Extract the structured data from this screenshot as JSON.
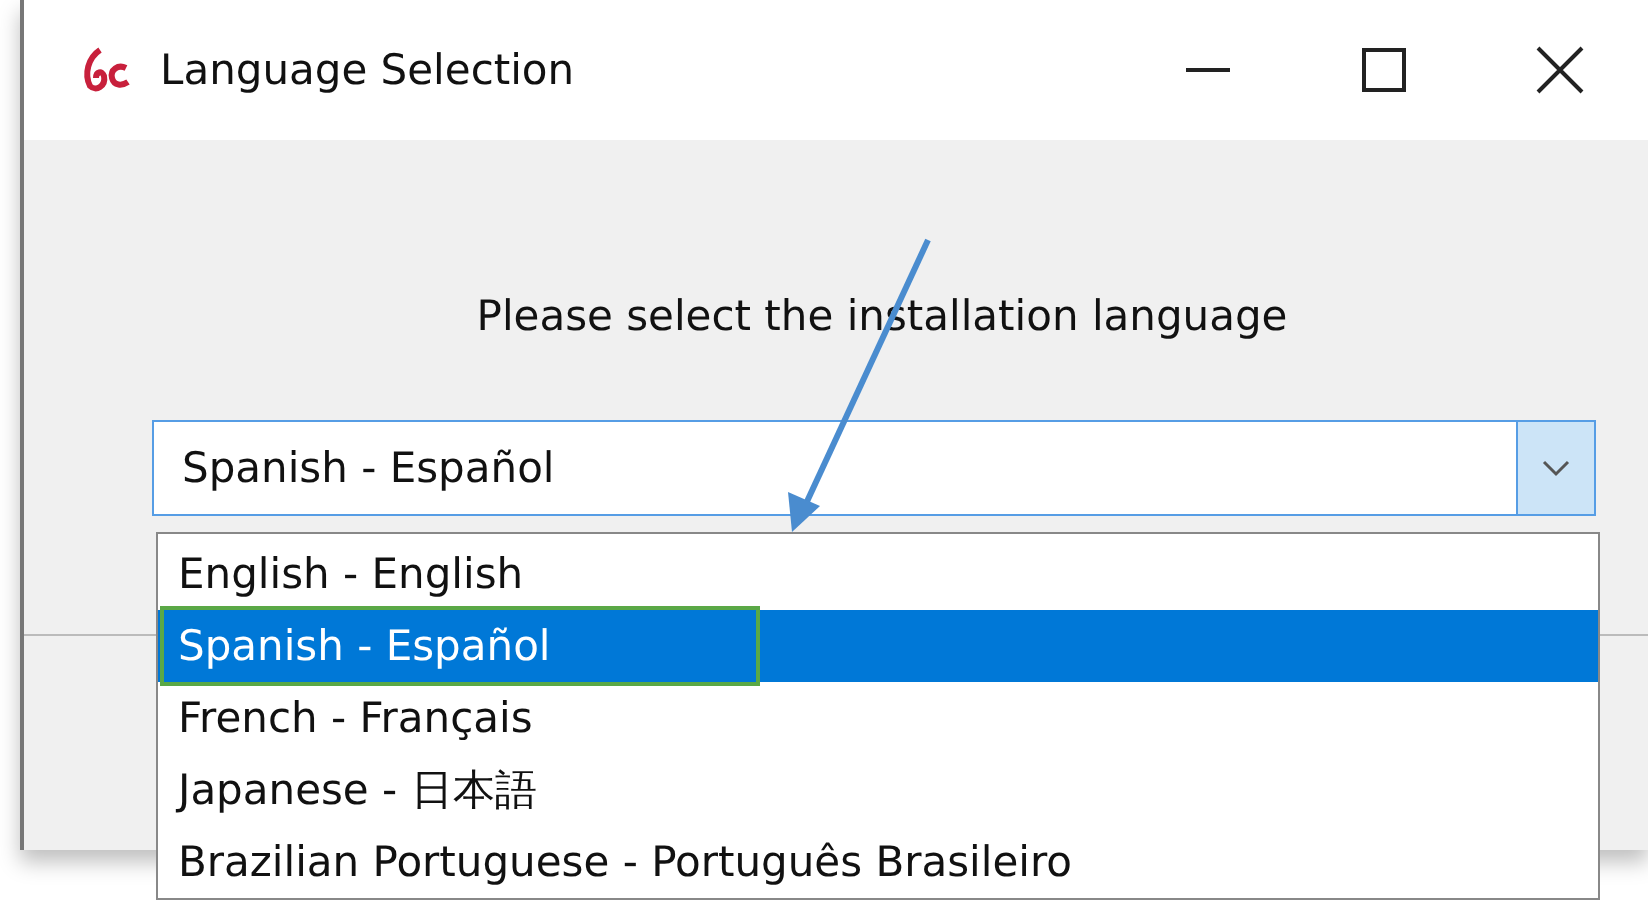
{
  "window": {
    "title": "Language Selection"
  },
  "prompt": "Please select the installation language",
  "language_combo": {
    "value": "Spanish - Español",
    "expanded": true
  },
  "options": [
    {
      "label": "English - English",
      "selected": false
    },
    {
      "label": "Spanish - Español",
      "selected": true
    },
    {
      "label": "French - Français",
      "selected": false
    },
    {
      "label": "Japanese - 日本語",
      "selected": false
    },
    {
      "label": "Brazilian Portuguese - Português Brasileiro",
      "selected": false
    }
  ]
}
